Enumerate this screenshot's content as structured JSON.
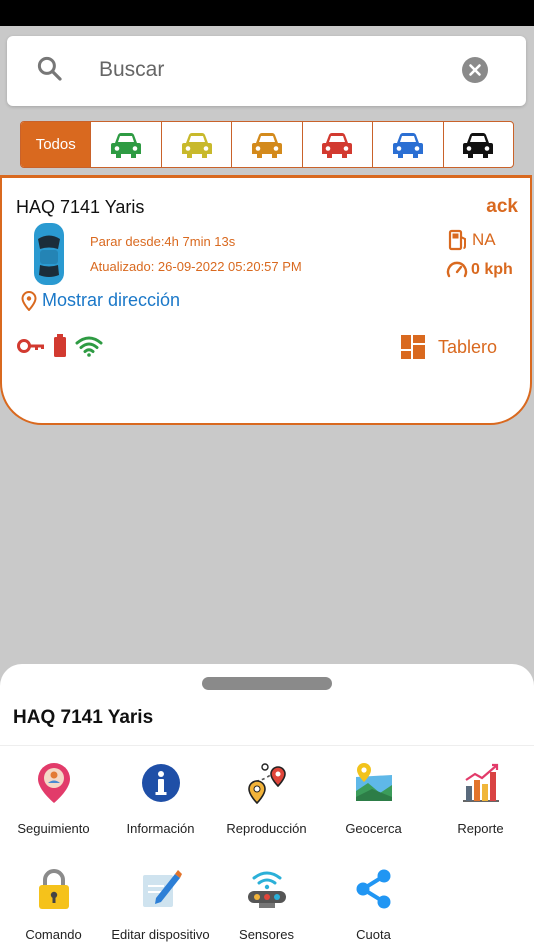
{
  "search": {
    "placeholder": "Buscar"
  },
  "filters": {
    "all_label": "Todos",
    "cars": [
      {
        "name": "green-car-icon",
        "color": "#2e9b43"
      },
      {
        "name": "yellow-car-icon",
        "color": "#c8b92c"
      },
      {
        "name": "orange-car-icon",
        "color": "#d38a1c"
      },
      {
        "name": "red-car-icon",
        "color": "#d23a30"
      },
      {
        "name": "blue-car-icon",
        "color": "#2b6fd3"
      },
      {
        "name": "black-car-icon",
        "color": "#111111"
      }
    ]
  },
  "vehicle": {
    "name": "HAQ 7141 Yaris",
    "ack_label": "ack",
    "stopped": "Parar desde:4h 7min 13s",
    "updated": "Atualizado: 26-09-2022 05:20:57 PM",
    "fuel": "NA",
    "speed": "0 kph",
    "address_link": "Mostrar dirección",
    "dashboard_label": "Tablero"
  },
  "sheet": {
    "title": "HAQ 7141 Yaris",
    "actions": [
      {
        "label": "Seguimiento",
        "icon": "tracking-pin-icon"
      },
      {
        "label": "Información",
        "icon": "info-icon"
      },
      {
        "label": "Reproducción",
        "icon": "replay-route-icon"
      },
      {
        "label": "Geocerca",
        "icon": "geofence-map-icon"
      },
      {
        "label": "Reporte",
        "icon": "report-chart-icon"
      },
      {
        "label": "Comando",
        "icon": "lock-icon"
      },
      {
        "label": "Editar dispositivo",
        "icon": "edit-device-icon"
      },
      {
        "label": "Sensores",
        "icon": "sensors-icon"
      },
      {
        "label": "Cuota",
        "icon": "share-icon"
      }
    ]
  },
  "colors": {
    "accent": "#d9691f",
    "link": "#1b78c8",
    "overlay": "#c9c9c9"
  }
}
